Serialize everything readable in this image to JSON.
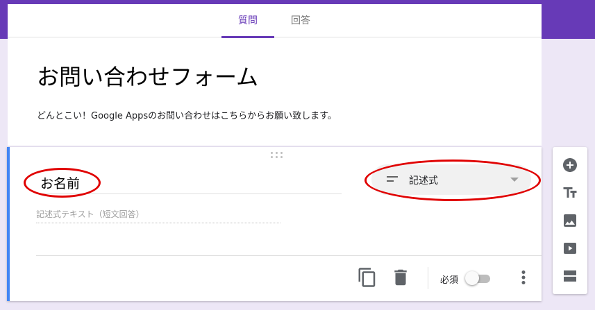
{
  "tabs": [
    {
      "label": "質問",
      "active": true
    },
    {
      "label": "回答",
      "active": false
    }
  ],
  "form": {
    "title": "お問い合わせフォーム",
    "description": "どんとこい！Google Appsのお問い合わせはこちらからお願い致します。"
  },
  "question": {
    "title": "お名前",
    "type_label": "記述式",
    "answer_placeholder": "記述式テキスト（短文回答）",
    "required_label": "必須",
    "required": false
  },
  "icons": {
    "drag": "drag-handle-icon",
    "type": "short-answer-icon",
    "dropdown": "dropdown-arrow-icon",
    "copy": "copy-icon",
    "delete": "delete-icon",
    "more": "more-vert-icon",
    "add_question": "add-circle-icon",
    "add_title": "title-icon",
    "add_image": "image-icon",
    "add_video": "video-icon",
    "add_section": "section-icon"
  },
  "colors": {
    "brand": "#673ab7",
    "page_background": "#ede7f6",
    "active_card_border": "#4285f4",
    "annotation_circle": "#e00000",
    "icon_gray": "#5f6368"
  }
}
